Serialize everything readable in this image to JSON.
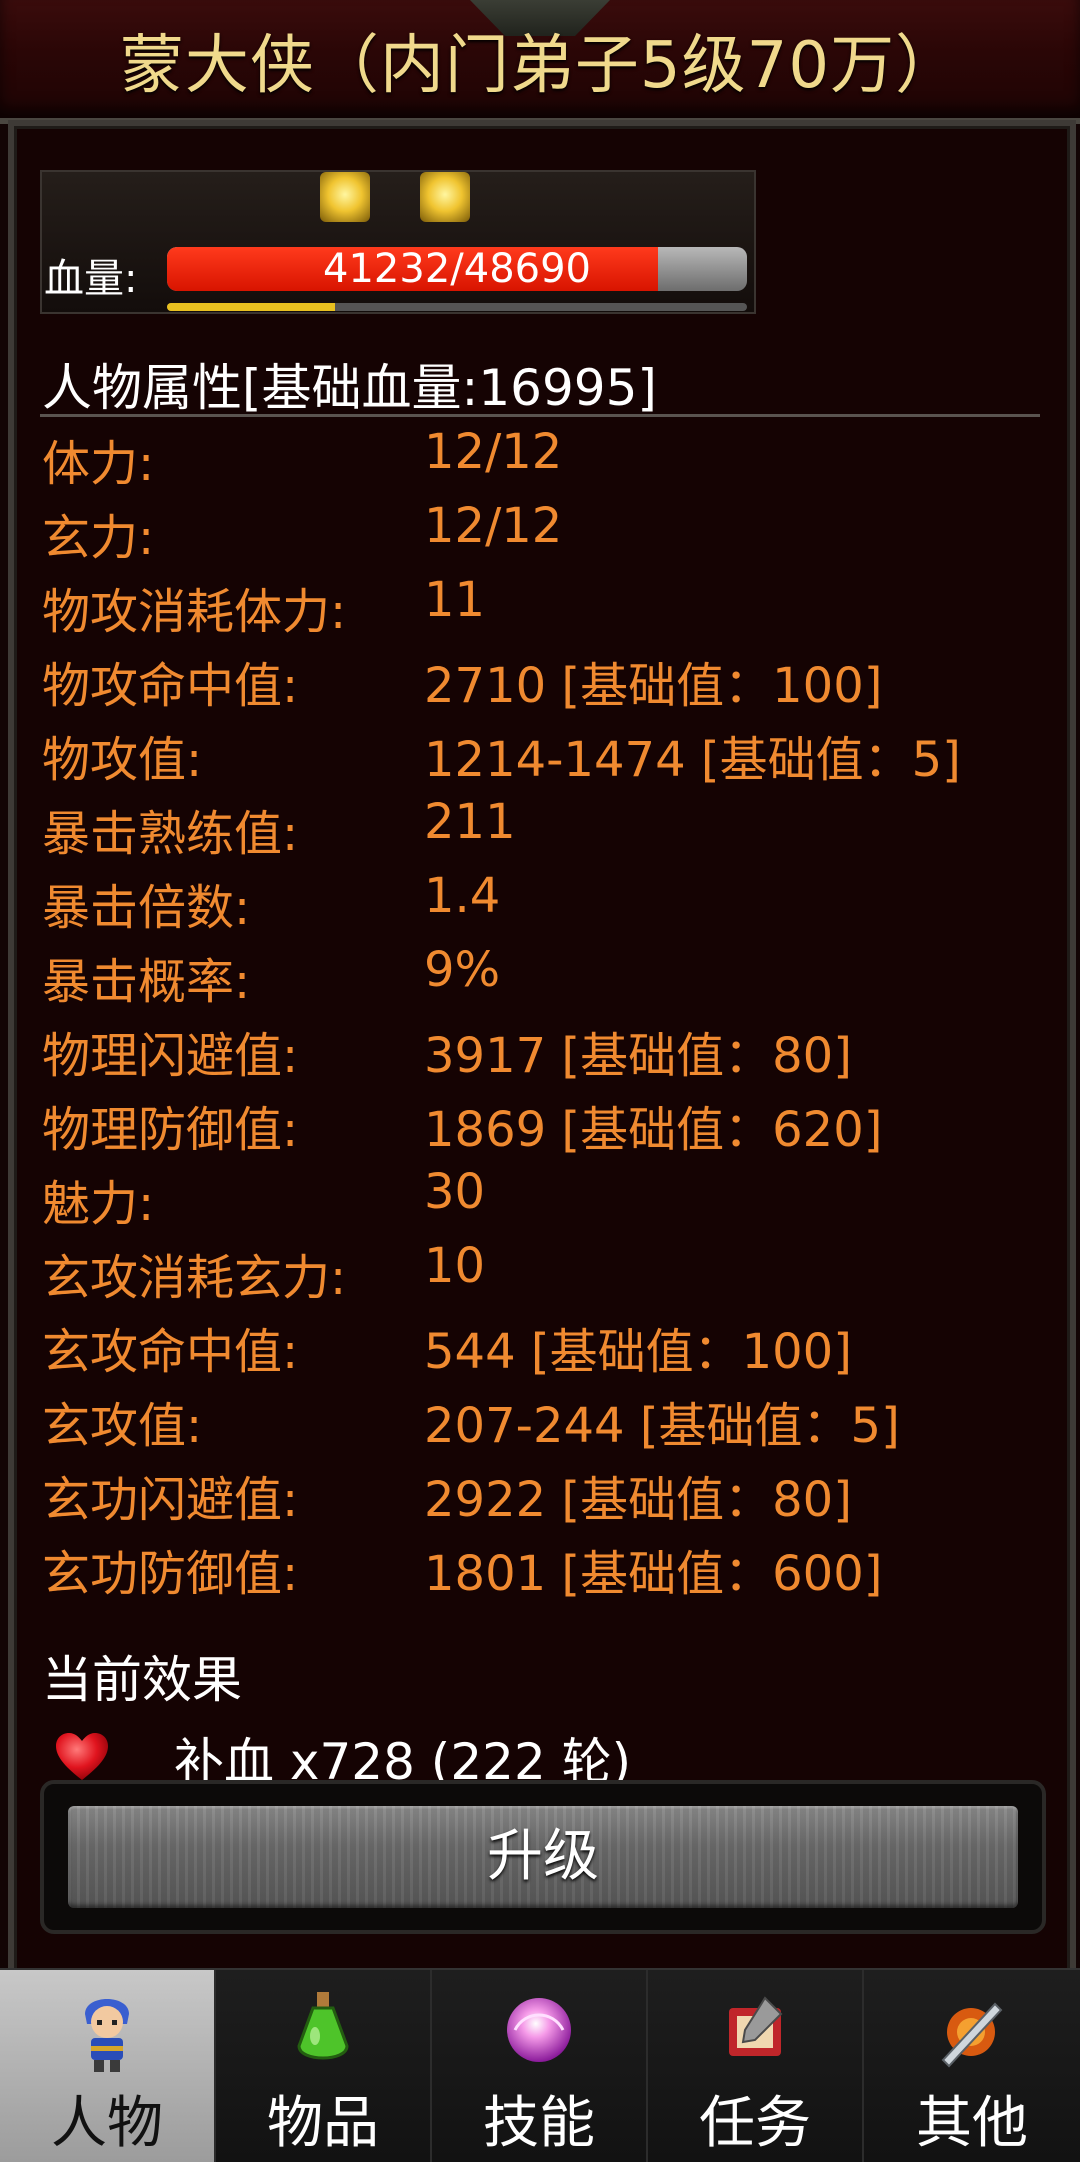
{
  "header": {
    "title": "蒙大侠（内门弟子5级70万）"
  },
  "hp": {
    "label": "血量:",
    "text": "41232/48690",
    "current": 41232,
    "max": 48690,
    "exp_fraction": 0.29
  },
  "attributes": {
    "section_title": "人物属性[基础血量:16995]",
    "rows": [
      {
        "label": "体力:",
        "value": "12/12"
      },
      {
        "label": "玄力:",
        "value": "12/12"
      },
      {
        "label": "物攻消耗体力:",
        "value": "11"
      },
      {
        "label": "物攻命中值:",
        "value": "2710 [基础值：100]"
      },
      {
        "label": "物攻值:",
        "value": "1214-1474 [基础值：5]"
      },
      {
        "label": "暴击熟练值:",
        "value": "211"
      },
      {
        "label": "暴击倍数:",
        "value": "1.4"
      },
      {
        "label": "暴击概率:",
        "value": "9%"
      },
      {
        "label": "物理闪避值:",
        "value": "3917 [基础值：80]"
      },
      {
        "label": "物理防御值:",
        "value": "1869 [基础值：620]"
      },
      {
        "label": "魅力:",
        "value": "30"
      },
      {
        "label": "玄攻消耗玄力:",
        "value": "10"
      },
      {
        "label": "玄攻命中值:",
        "value": "544 [基础值：100]"
      },
      {
        "label": "玄攻值:",
        "value": "207-244 [基础值：5]"
      },
      {
        "label": "玄功闪避值:",
        "value": "2922 [基础值：80]"
      },
      {
        "label": "玄功防御值:",
        "value": "1801 [基础值：600]"
      }
    ]
  },
  "effects": {
    "title": "当前效果",
    "items": [
      {
        "icon": "heart-icon",
        "text": "补血 x728 (222 轮)"
      }
    ]
  },
  "upgrade_button": {
    "label": "升级"
  },
  "nav": {
    "tabs": [
      {
        "label": "人物",
        "icon": "character-icon",
        "active": true
      },
      {
        "label": "物品",
        "icon": "potion-icon",
        "active": false
      },
      {
        "label": "技能",
        "icon": "skill-orb-icon",
        "active": false
      },
      {
        "label": "任务",
        "icon": "quest-icon",
        "active": false
      },
      {
        "label": "其他",
        "icon": "other-icon",
        "active": false
      }
    ]
  }
}
